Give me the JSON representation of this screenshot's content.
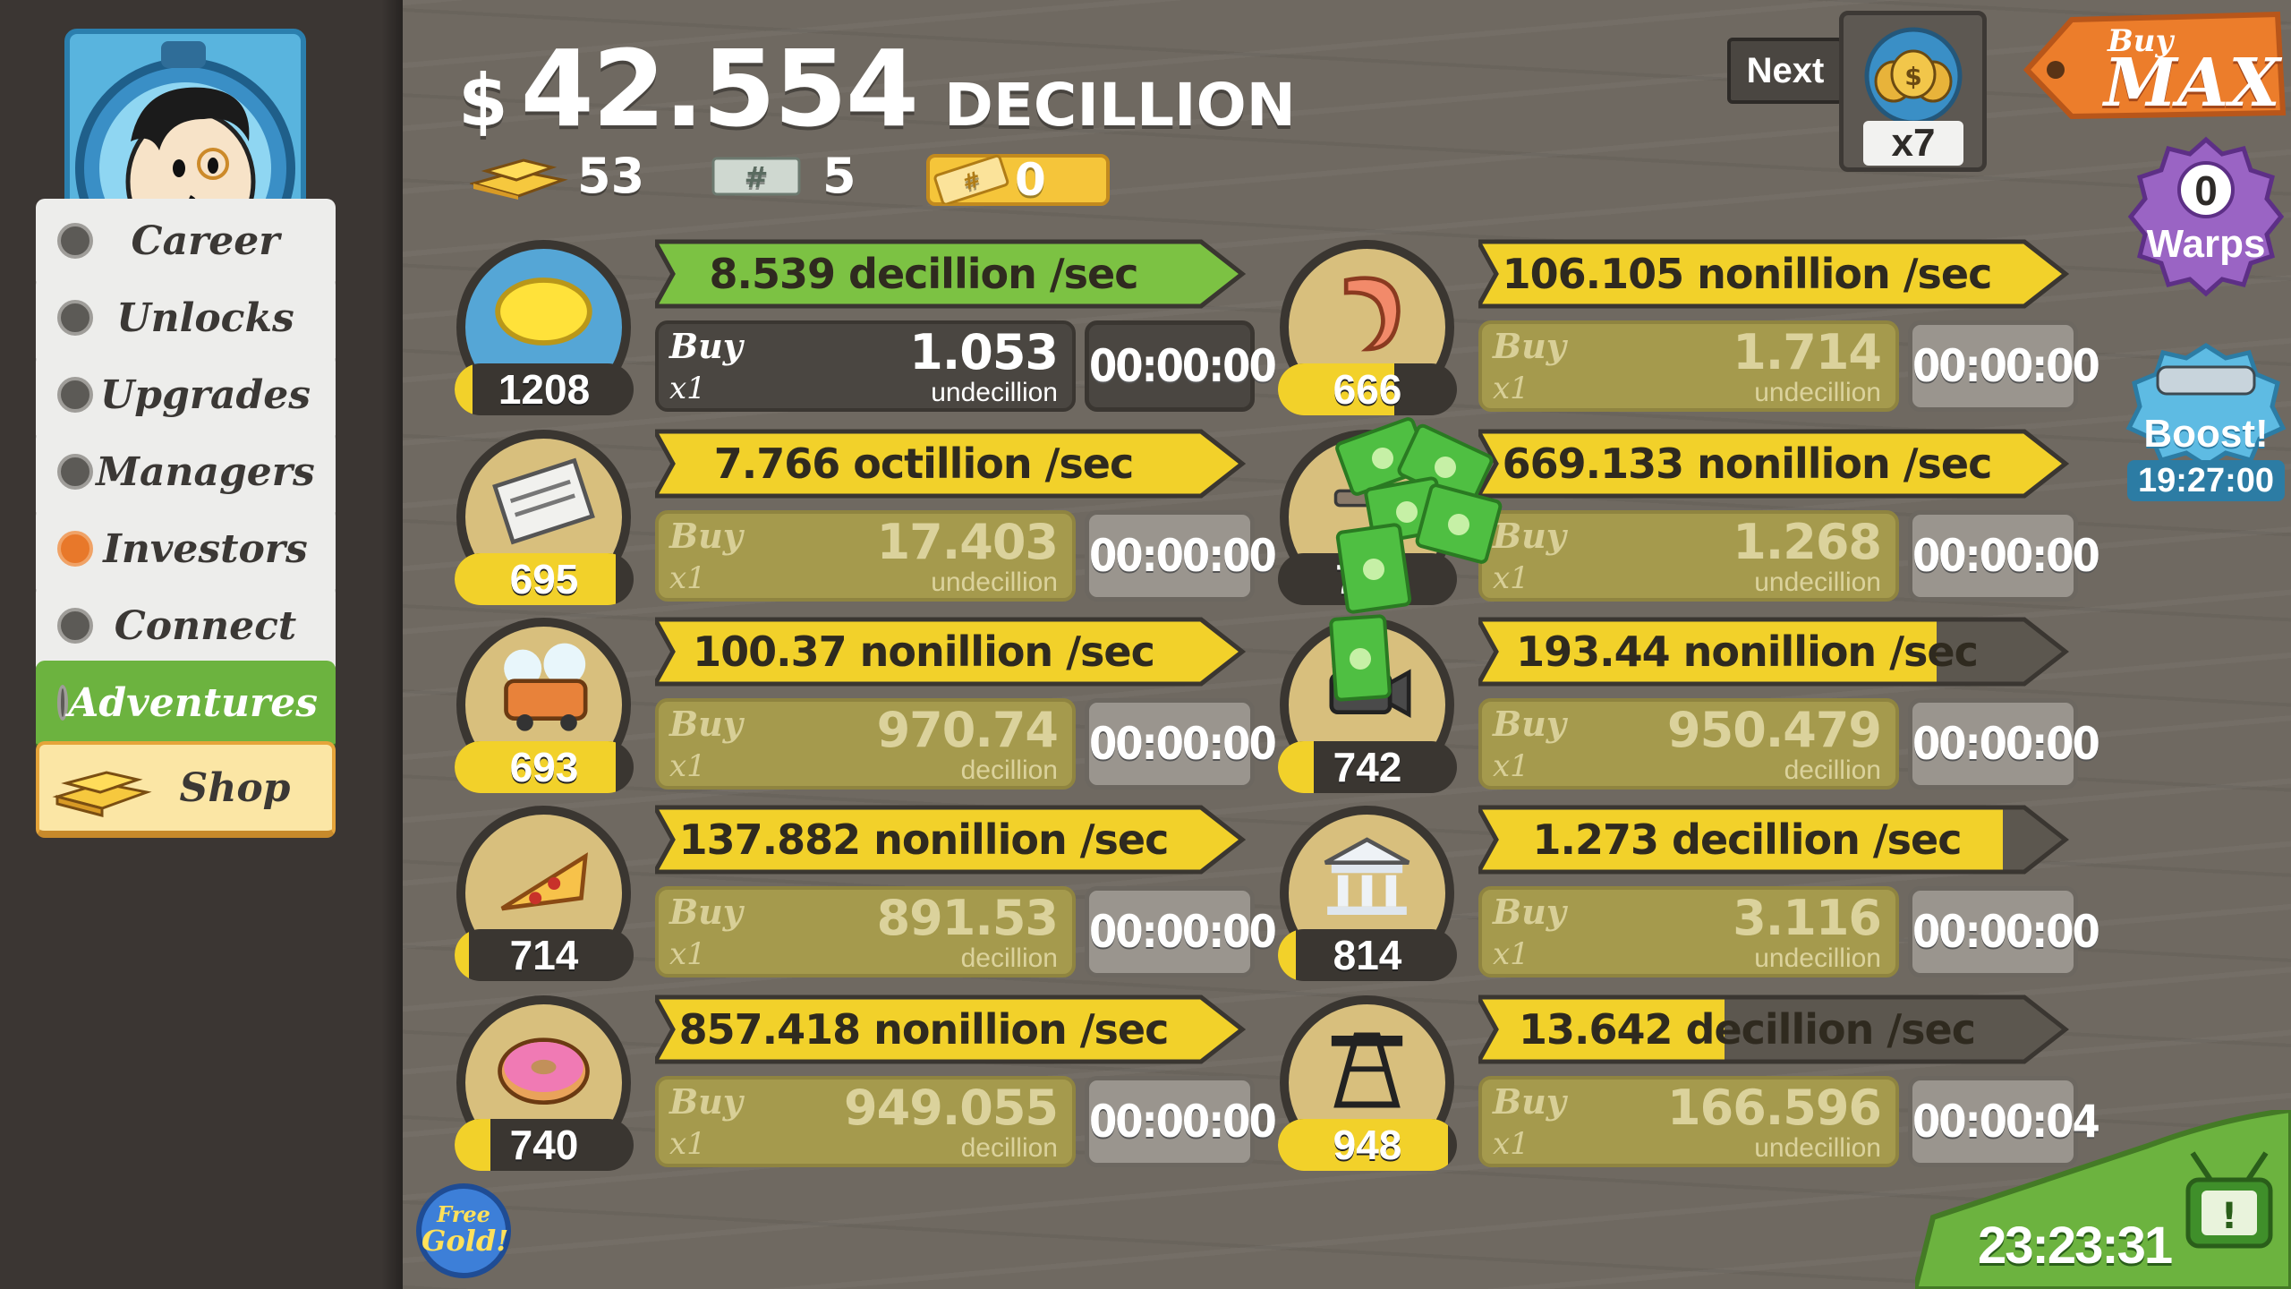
{
  "header": {
    "currency_symbol": "$",
    "money_amount": "42.554",
    "money_unit": "DECILLION",
    "gold_count": "53",
    "megabucks_count": "5",
    "tickets_count": "0"
  },
  "sidebar": {
    "items": [
      {
        "label": "Career",
        "dot_color": "#5c5a56"
      },
      {
        "label": "Unlocks",
        "dot_color": "#5c5a56"
      },
      {
        "label": "Upgrades",
        "dot_color": "#5c5a56"
      },
      {
        "label": "Managers",
        "dot_color": "#5c5a56"
      },
      {
        "label": "Investors",
        "dot_color": "#e8782a"
      },
      {
        "label": "Connect",
        "dot_color": "#5c5a56"
      },
      {
        "label": "Adventures",
        "dot_color": "#5c5a56"
      }
    ],
    "shop_label": "Shop",
    "free_gold_line1": "Free",
    "free_gold_line2": "Gold!"
  },
  "top_right": {
    "next_label": "Next",
    "multiplier": "x7",
    "buy_word": "Buy",
    "max_word": "MAX",
    "warps_count": "0",
    "warps_label": "Warps",
    "boost_label": "Boost!",
    "boost_timer": "19:27:00",
    "tv_timer": "23:23:31"
  },
  "businesses": [
    {
      "icon": "lemon-icon",
      "count": "1208",
      "count_progress": 0.1,
      "rate": "8.539 decillion /sec",
      "rate_progress": 1.0,
      "bar_color": "#7cc243",
      "buy_word": "Buy",
      "buy_qty": "x1",
      "price": "1.053",
      "price_unit": "undecillion",
      "timer": "00:00:00",
      "affordable": false,
      "circle": "blue"
    },
    {
      "icon": "newspaper-icon",
      "count": "695",
      "count_progress": 0.9,
      "rate": "7.766 octillion /sec",
      "rate_progress": 1.0,
      "bar_color": "#f2d12a",
      "buy_word": "Buy",
      "buy_qty": "x1",
      "price": "17.403",
      "price_unit": "undecillion",
      "timer": "00:00:00",
      "affordable": true,
      "circle": "beige"
    },
    {
      "icon": "car-wash-icon",
      "count": "693",
      "count_progress": 0.9,
      "rate": "100.37 nonillion /sec",
      "rate_progress": 1.0,
      "bar_color": "#f2d12a",
      "buy_word": "Buy",
      "buy_qty": "x1",
      "price": "970.74",
      "price_unit": "decillion",
      "timer": "00:00:00",
      "affordable": true,
      "circle": "beige"
    },
    {
      "icon": "pizza-icon",
      "count": "714",
      "count_progress": 0.08,
      "rate": "137.882 nonillion /sec",
      "rate_progress": 1.0,
      "bar_color": "#f2d12a",
      "buy_word": "Buy",
      "buy_qty": "x1",
      "price": "891.53",
      "price_unit": "decillion",
      "timer": "00:00:00",
      "affordable": true,
      "circle": "beige"
    },
    {
      "icon": "donut-icon",
      "count": "740",
      "count_progress": 0.2,
      "rate": "857.418 nonillion /sec",
      "rate_progress": 1.0,
      "bar_color": "#f2d12a",
      "buy_word": "Buy",
      "buy_qty": "x1",
      "price": "949.055",
      "price_unit": "decillion",
      "timer": "00:00:00",
      "affordable": true,
      "circle": "beige"
    },
    {
      "icon": "shrimp-icon",
      "count": "666",
      "count_progress": 0.65,
      "rate": "106.105 nonillion /sec",
      "rate_progress": 1.0,
      "bar_color": "#f2d12a",
      "buy_word": "Buy",
      "buy_qty": "x1",
      "price": "1.714",
      "price_unit": "undecillion",
      "timer": "00:00:00",
      "affordable": true,
      "circle": "beige"
    },
    {
      "icon": "hockey-icon",
      "count": "7…",
      "count_progress": 0.0,
      "rate": "669.133 nonillion /sec",
      "rate_progress": 1.0,
      "bar_color": "#f2d12a",
      "buy_word": "Buy",
      "buy_qty": "x1",
      "price": "1.268",
      "price_unit": "undecillion",
      "timer": "00:00:00",
      "affordable": true,
      "circle": "beige"
    },
    {
      "icon": "movie-camera-icon",
      "count": "742",
      "count_progress": 0.2,
      "rate": "193.44 nonillion /sec",
      "rate_progress": 0.84,
      "bar_color": "#f2d12a",
      "buy_word": "Buy",
      "buy_qty": "x1",
      "price": "950.479",
      "price_unit": "decillion",
      "timer": "00:00:00",
      "affordable": true,
      "circle": "beige"
    },
    {
      "icon": "bank-icon",
      "count": "814",
      "count_progress": 0.1,
      "rate": "1.273 decillion /sec",
      "rate_progress": 0.96,
      "bar_color": "#f2d12a",
      "buy_word": "Buy",
      "buy_qty": "x1",
      "price": "3.116",
      "price_unit": "undecillion",
      "timer": "00:00:00",
      "affordable": true,
      "circle": "beige"
    },
    {
      "icon": "oil-rig-icon",
      "count": "948",
      "count_progress": 0.95,
      "rate": "13.642 decillion /sec",
      "rate_progress": 0.45,
      "bar_color": "#f2d12a",
      "buy_word": "Buy",
      "buy_qty": "x1",
      "price": "166.596",
      "price_unit": "undecillion",
      "timer": "00:00:04",
      "affordable": true,
      "circle": "beige"
    }
  ]
}
